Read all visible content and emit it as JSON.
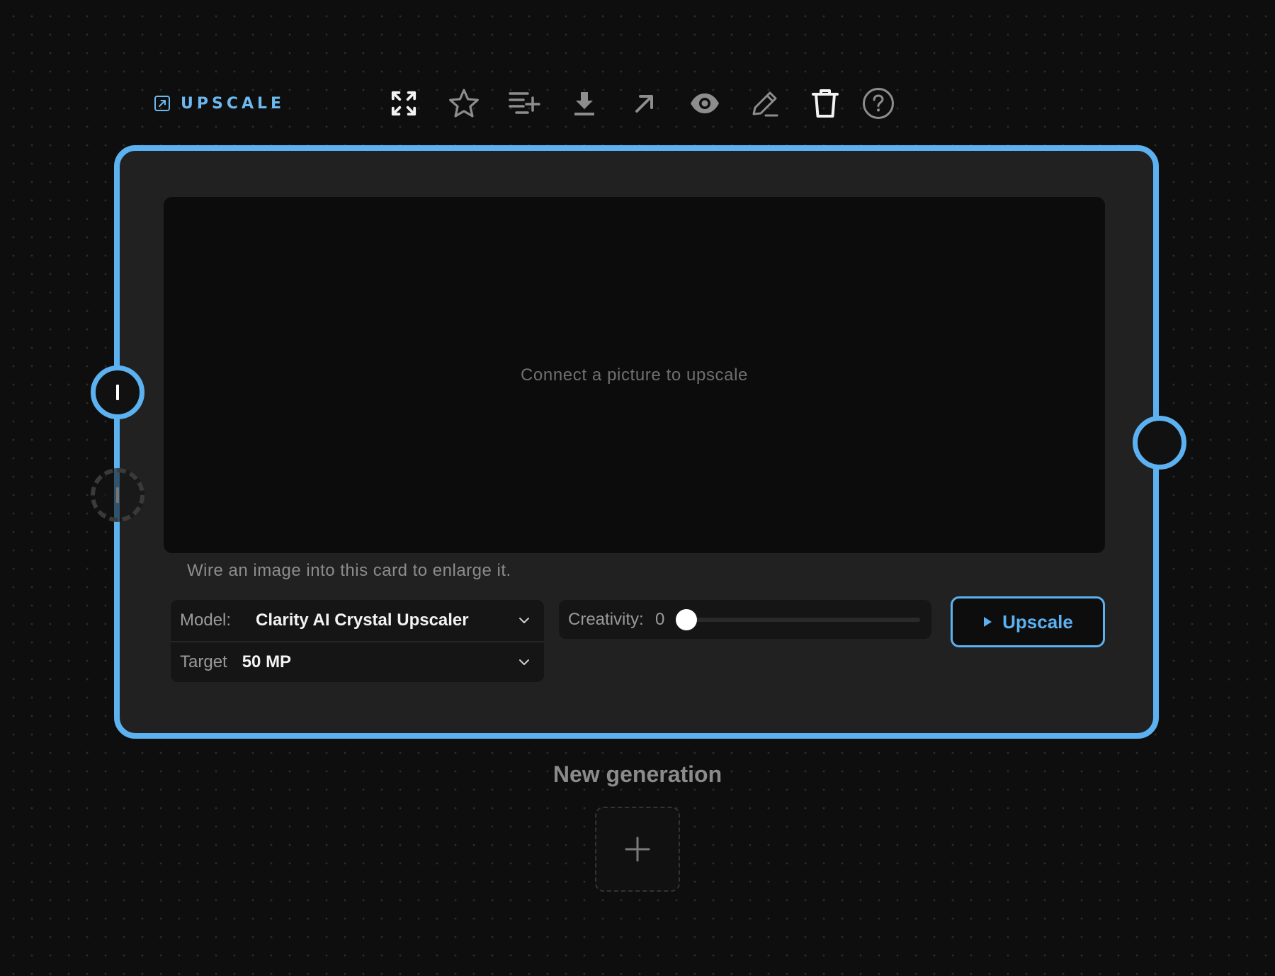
{
  "node": {
    "icon": "external-link-square-icon",
    "title": "UPSCALE"
  },
  "toolbar": {
    "items": [
      {
        "icon": "fullscreen-icon",
        "active": true
      },
      {
        "icon": "star-icon",
        "active": false
      },
      {
        "icon": "add-to-list-icon",
        "active": false
      },
      {
        "icon": "download-icon",
        "active": false
      },
      {
        "icon": "arrow-up-right-icon",
        "active": false
      },
      {
        "icon": "eye-icon",
        "active": false
      },
      {
        "icon": "pencil-icon",
        "active": false
      },
      {
        "icon": "trash-icon",
        "active": true
      },
      {
        "icon": "help-icon",
        "active": false
      }
    ]
  },
  "card": {
    "preview_text": "Connect a picture to upscale",
    "hint": "Wire an image into this card to enlarge it.",
    "model": {
      "label": "Model:",
      "value": "Clarity AI Crystal Upscaler"
    },
    "target": {
      "label": "Target",
      "value": "50 MP"
    },
    "creativity": {
      "label": "Creativity:",
      "value": "0",
      "fraction": 0.0
    },
    "run_button": {
      "icon": "play-icon",
      "label": "Upscale"
    }
  },
  "new_generation": {
    "label": "New generation",
    "add_icon": "plus-icon"
  },
  "colors": {
    "accent": "#5cb1f0",
    "background": "#0e0e0e",
    "card": "#212121",
    "preview": "#0c0c0c"
  }
}
